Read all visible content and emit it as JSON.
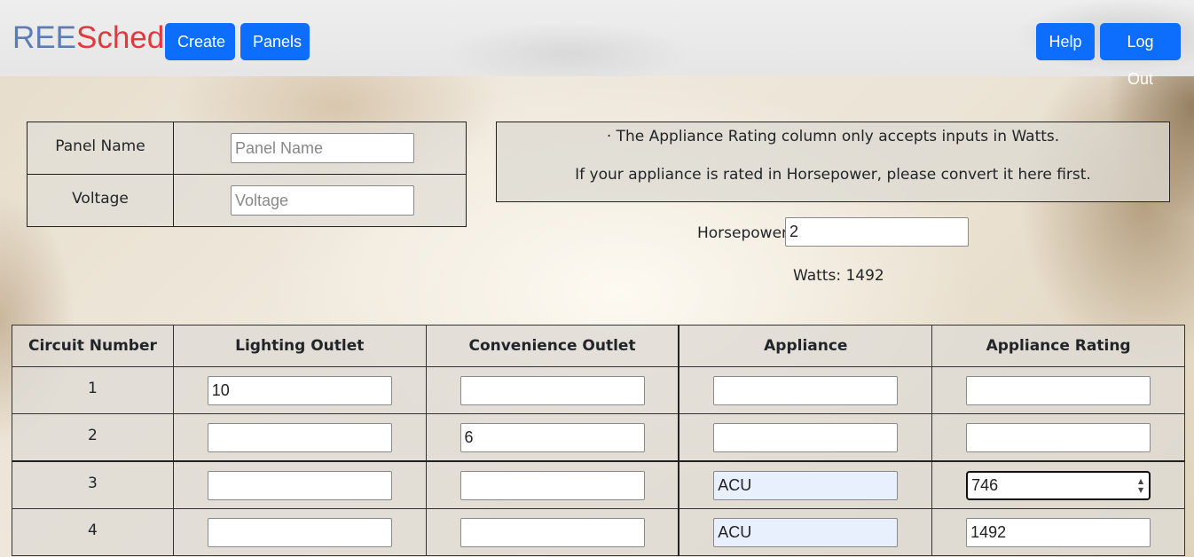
{
  "navbar": {
    "brand_part1": "REE",
    "brand_part2": "Sched",
    "create_label": "Create",
    "panels_label": "Panels",
    "help_label": "Help",
    "logout_label": "Log Out"
  },
  "panel_info": {
    "name_label": "Panel Name",
    "name_placeholder": "Panel Name",
    "name_value": "",
    "voltage_label": "Voltage",
    "voltage_placeholder": "Voltage",
    "voltage_value": ""
  },
  "notice": {
    "line1": "· The Appliance Rating column only accepts inputs in Watts.",
    "line2": "If your appliance is rated in Horsepower, please convert it here first."
  },
  "converter": {
    "hp_label": "Horsepower",
    "hp_value": "2",
    "watts_text": "Watts: 1492"
  },
  "table": {
    "headers": [
      "Circuit Number",
      "Lighting Outlet",
      "Convenience Outlet",
      "Appliance",
      "Appliance Rating"
    ],
    "rows": [
      {
        "circuit": "1",
        "lighting": "10",
        "convenience": "",
        "appliance": "",
        "rating": ""
      },
      {
        "circuit": "2",
        "lighting": "",
        "convenience": "6",
        "appliance": "",
        "rating": ""
      },
      {
        "circuit": "3",
        "lighting": "",
        "convenience": "",
        "appliance": "ACU",
        "rating": "746"
      },
      {
        "circuit": "4",
        "lighting": "",
        "convenience": "",
        "appliance": "ACU",
        "rating": "1492"
      }
    ]
  },
  "colors": {
    "primary_button": "#0d6efd",
    "brand_ree": "#5a7db6",
    "brand_sched": "#e0393f",
    "autofill_bg": "#e8f0fe"
  }
}
